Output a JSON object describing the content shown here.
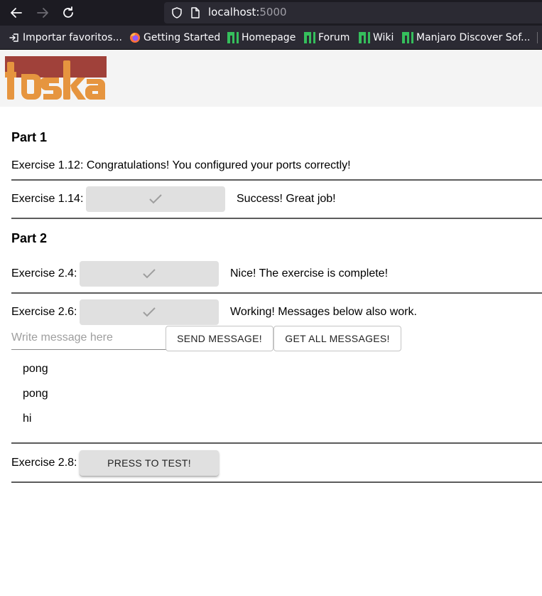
{
  "browser": {
    "url_host": "localhost:",
    "url_port": "5000",
    "bookmarks": [
      {
        "label": "Importar favoritos..."
      },
      {
        "label": "Getting Started"
      },
      {
        "label": "Homepage"
      },
      {
        "label": "Forum"
      },
      {
        "label": "Wiki"
      },
      {
        "label": "Manjaro Discover Sof..."
      }
    ]
  },
  "logo": {
    "text": "toska",
    "colors": {
      "top": "#a0413a",
      "letters": "#e6953f"
    }
  },
  "part1": {
    "title": "Part 1",
    "ex112": "Exercise 1.12: Congratulations! You configured your ports correctly!",
    "ex114_label": "Exercise 1.14:",
    "ex114_status": "Success! Great job!"
  },
  "part2": {
    "title": "Part 2",
    "ex24_label": "Exercise 2.4:",
    "ex24_status": "Nice! The exercise is complete!",
    "ex26_label": "Exercise 2.6:",
    "ex26_status": "Working! Messages below also work.",
    "message_placeholder": "Write message here",
    "send_label": "SEND MESSAGE!",
    "get_all_label": "GET ALL MESSAGES!",
    "messages": [
      "pong",
      "pong",
      "hi"
    ],
    "ex28_label": "Exercise 2.8:",
    "press_label": "PRESS TO TEST!"
  },
  "colors": {
    "divider": "#5c5c5c",
    "success_button": "#e0e0e0",
    "check": "#9e9e9e"
  }
}
